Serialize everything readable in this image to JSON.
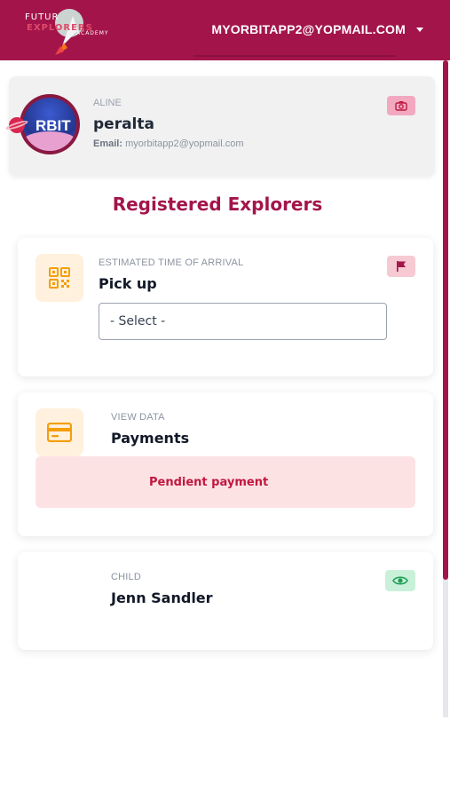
{
  "header": {
    "logo": {
      "line1": "FUTUR",
      "line2": "EXPLORERS",
      "line3": "ACADEMY"
    },
    "account_email": "MYORBITAPP2@YOPMAIL.COM",
    "account_menu_icon": "chevron-down-icon"
  },
  "profile": {
    "avatar_text": "RBIT",
    "label": "ALINE",
    "name": "peralta",
    "email_label": "Email:",
    "email": "myorbitapp2@yopmail.com",
    "action_icon": "camera-icon"
  },
  "section_title": "Registered Explorers",
  "cards": {
    "pickup": {
      "icon": "qr-code-icon",
      "label": "ESTIMATED TIME OF ARRIVAL",
      "title": "Pick up",
      "select_value": "- Select -",
      "action_icon": "flag-icon"
    },
    "payments": {
      "icon": "credit-card-icon",
      "label": "VIEW DATA",
      "title": "Payments",
      "alert": "Pendient payment"
    },
    "child": {
      "label": "CHILD",
      "title": "Jenn Sandler",
      "action_icon": "eye-icon"
    }
  },
  "colors": {
    "brand": "#a3154a",
    "alert_bg": "#fde2e4",
    "alert_text": "#c0183f",
    "icon_box_bg": "#fff1dd",
    "icon_orange": "#f59e0b",
    "view_btn_bg": "#c9f1da",
    "view_icon": "#1f9d55"
  }
}
